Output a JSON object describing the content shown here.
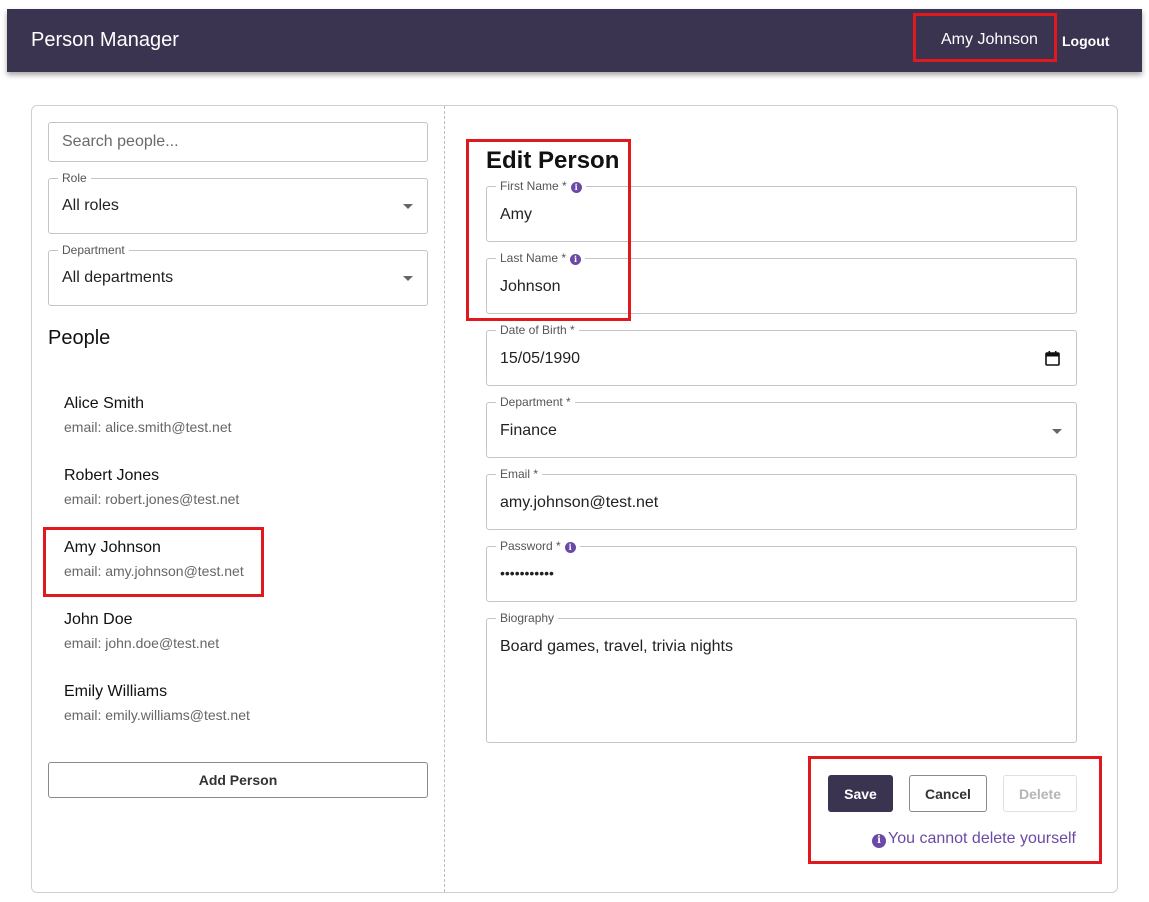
{
  "header": {
    "app_title": "Person Manager",
    "user_name": "Amy Johnson",
    "logout_label": "Logout"
  },
  "sidebar": {
    "search_placeholder": "Search people...",
    "role_filter": {
      "label": "Role",
      "value": "All roles"
    },
    "department_filter": {
      "label": "Department",
      "value": "All departments"
    },
    "people_heading": "People",
    "people": [
      {
        "name": "Alice Smith",
        "email": "email: alice.smith@test.net"
      },
      {
        "name": "Robert Jones",
        "email": "email: robert.jones@test.net"
      },
      {
        "name": "Amy Johnson",
        "email": "email: amy.johnson@test.net"
      },
      {
        "name": "John Doe",
        "email": "email: john.doe@test.net"
      },
      {
        "name": "Emily Williams",
        "email": "email: emily.williams@test.net"
      }
    ],
    "add_person_label": "Add Person"
  },
  "form": {
    "title": "Edit Person",
    "first_name": {
      "label": "First Name *",
      "value": "Amy"
    },
    "last_name": {
      "label": "Last Name *",
      "value": "Johnson"
    },
    "date_of_birth": {
      "label": "Date of Birth *",
      "value": "15/05/1990"
    },
    "department": {
      "label": "Department *",
      "value": "Finance"
    },
    "email": {
      "label": "Email *",
      "value": "amy.johnson@test.net"
    },
    "password": {
      "label": "Password *",
      "value": "•••••••••••"
    },
    "biography": {
      "label": "Biography",
      "value": "Board games, travel, trivia nights"
    },
    "save_label": "Save",
    "cancel_label": "Cancel",
    "delete_label": "Delete",
    "delete_note": "You cannot delete yourself"
  },
  "colors": {
    "appbar": "#3a3450",
    "accent": "#6a4aa6",
    "highlight_box": "#e0191f"
  },
  "icons": {
    "info": "info-icon",
    "dropdown": "chevron-down-icon",
    "calendar": "calendar-icon"
  }
}
